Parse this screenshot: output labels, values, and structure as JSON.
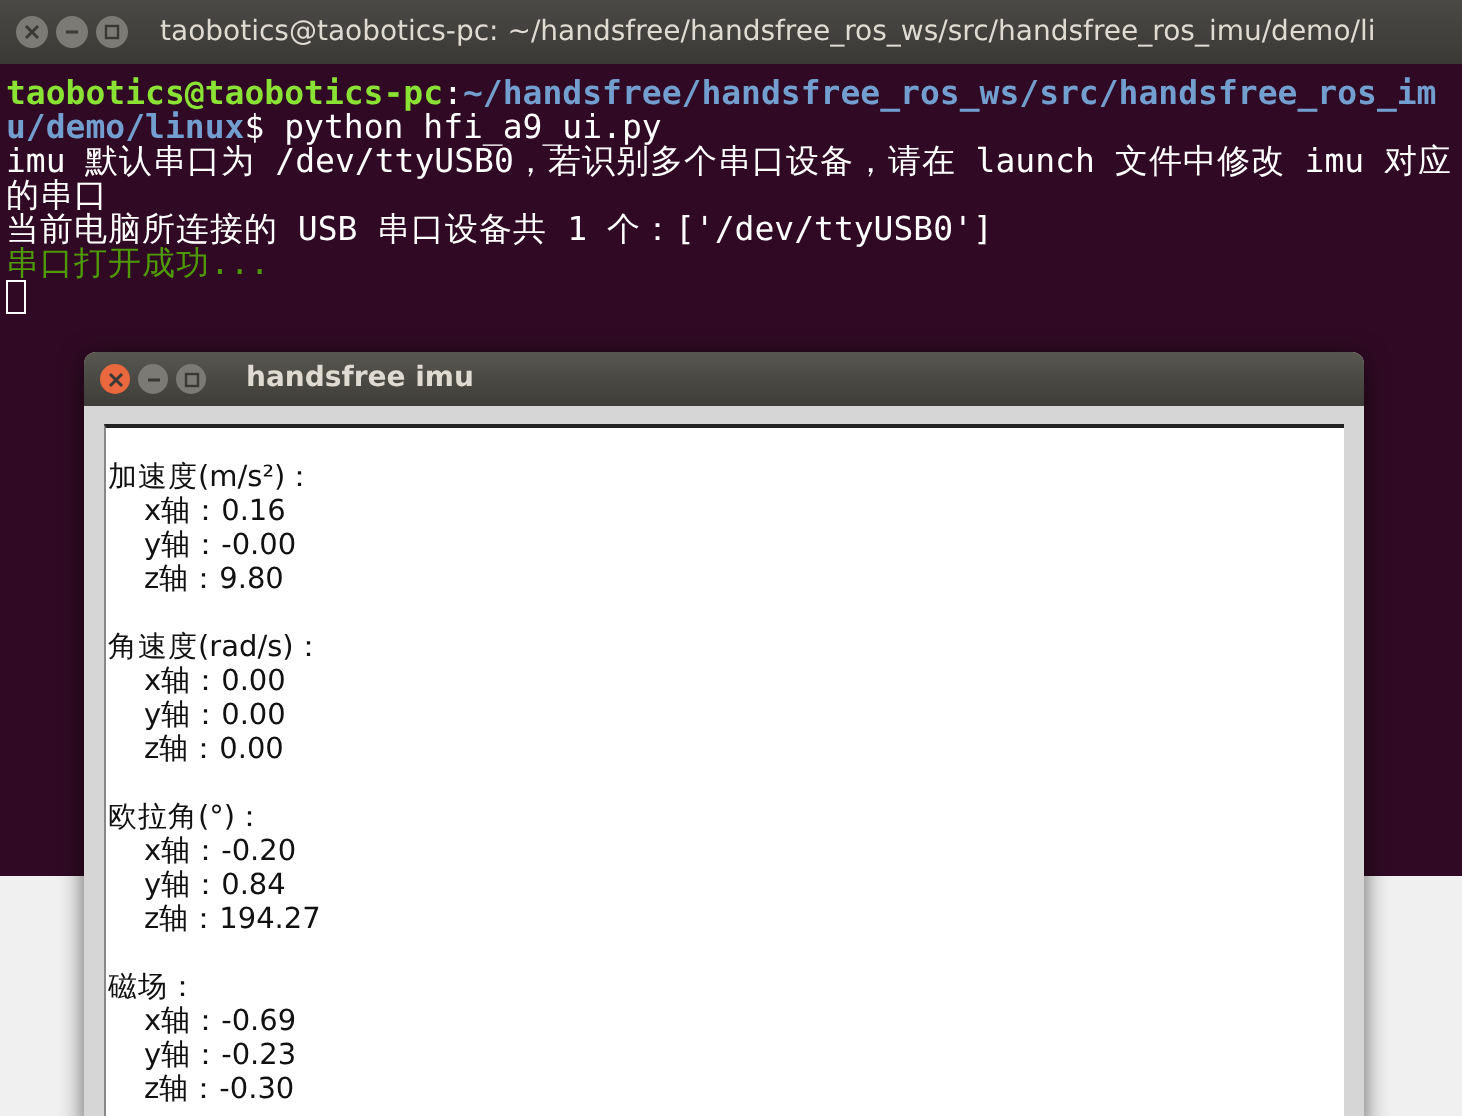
{
  "terminal": {
    "title": "taobotics@taobotics-pc: ~/handsfree/handsfree_ros_ws/src/handsfree_ros_imu/demo/li",
    "lines": [
      {
        "kind": "prompt",
        "user": "taobotics@taobotics-pc",
        "separator": ":",
        "path": "~/handsfree/handsfree_ros_ws/src/handsfree_ros_imu/demo/linux",
        "symbol": "$",
        "command": "python hfi_a9_ui.py"
      },
      {
        "kind": "output",
        "text": "imu 默认串口为 /dev/ttyUSB0，若识别多个串口设备，请在 launch 文件中修改 imu 对应的串口"
      },
      {
        "kind": "output",
        "text": "当前电脑所连接的 USB 串口设备共 1 个：['/dev/ttyUSB0']"
      },
      {
        "kind": "success",
        "text": "串口打开成功..."
      }
    ],
    "cursor": true
  },
  "imu_window": {
    "title": "handsfree imu",
    "sections": [
      {
        "heading": "加速度(m/s²)：",
        "axes": [
          {
            "label": "x轴：",
            "value": "0.16"
          },
          {
            "label": "y轴：",
            "value": "-0.00"
          },
          {
            "label": "z轴：",
            "value": "9.80"
          }
        ]
      },
      {
        "heading": "角速度(rad/s)：",
        "axes": [
          {
            "label": "x轴：",
            "value": "0.00"
          },
          {
            "label": "y轴：",
            "value": "0.00"
          },
          {
            "label": "z轴：",
            "value": "0.00"
          }
        ]
      },
      {
        "heading": "欧拉角(°)：",
        "axes": [
          {
            "label": "x轴：",
            "value": "-0.20"
          },
          {
            "label": "y轴：",
            "value": "0.84"
          },
          {
            "label": "z轴：",
            "value": "194.27"
          }
        ]
      },
      {
        "heading": "磁场：",
        "axes": [
          {
            "label": "x轴：",
            "value": "-0.69"
          },
          {
            "label": "y轴：",
            "value": "-0.23"
          },
          {
            "label": "z轴：",
            "value": "-0.30"
          }
        ]
      }
    ]
  }
}
